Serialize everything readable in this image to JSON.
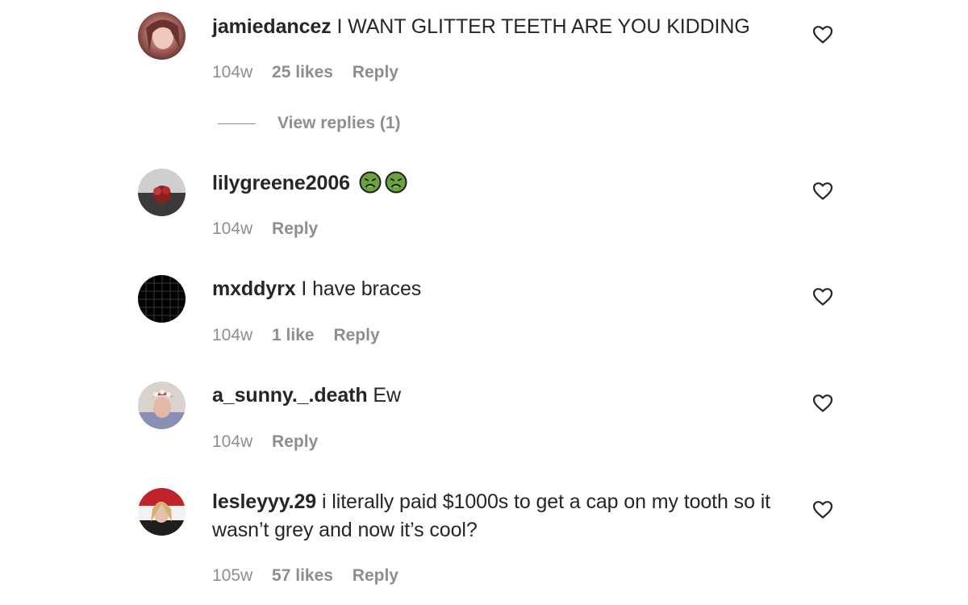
{
  "comments": [
    {
      "username": "jamiedancez",
      "text": "I WANT GLITTER TEETH ARE YOU KIDDING",
      "age": "104w",
      "likes": "25 likes",
      "reply": "Reply",
      "view_replies": "View replies (1)"
    },
    {
      "username": "lilygreene2006",
      "text": "",
      "emojis": [
        "nauseated-face",
        "nauseated-face"
      ],
      "age": "104w",
      "reply": "Reply"
    },
    {
      "username": "mxddyrx",
      "text": "I have braces",
      "age": "104w",
      "likes": "1 like",
      "reply": "Reply"
    },
    {
      "username": "a_sunny._.death",
      "text": "Ew",
      "age": "104w",
      "reply": "Reply"
    },
    {
      "username": "lesleyyy.29",
      "text": "i literally paid $1000s to get a cap on my tooth so it wasn’t grey and now it’s cool?",
      "age": "105w",
      "likes": "57 likes",
      "reply": "Reply"
    }
  ],
  "icons": {
    "like": "heart-outline-icon",
    "emoji": "nauseated-face-icon"
  },
  "colors": {
    "text_primary": "#262626",
    "text_secondary": "#8e8e8e",
    "background": "#ffffff",
    "emoji_green": "#6aa33b"
  }
}
